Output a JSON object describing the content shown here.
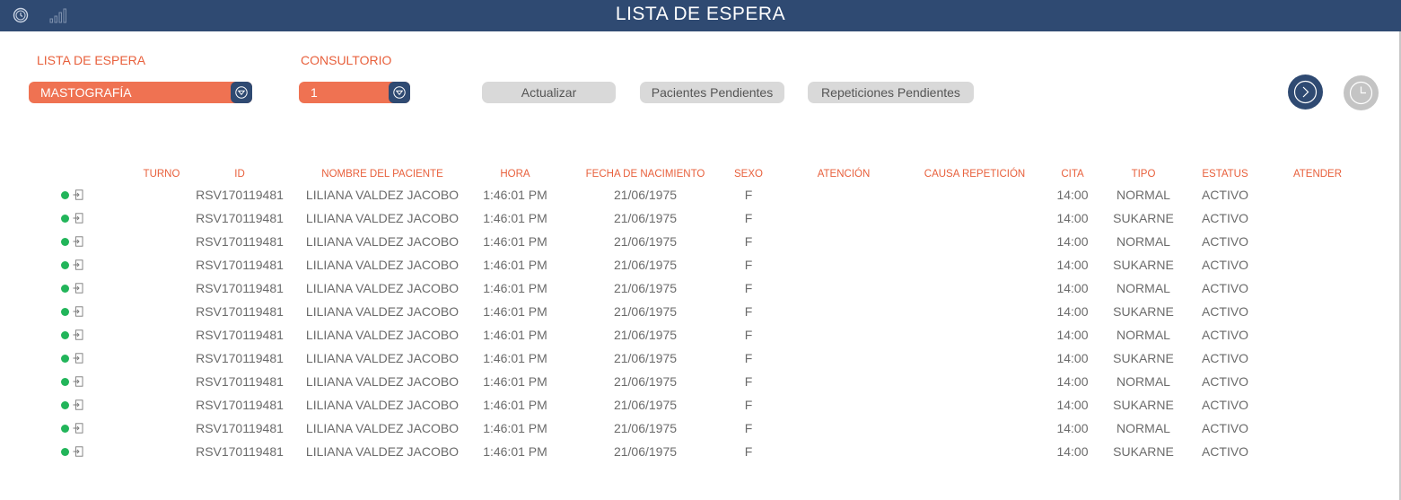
{
  "header": {
    "title": "LISTA DE ESPERA",
    "history_icon": "history-icon",
    "chart_icon": "signal-bars-icon"
  },
  "colors": {
    "header_bg": "#2f4a72",
    "accent": "#ef7252",
    "label": "#e8603c",
    "status_dot": "#22b55a",
    "button_bg": "#d9d9d9"
  },
  "filters": {
    "lista_label": "LISTA DE ESPERA",
    "lista_value": "MASTOGRAFÍA",
    "consultorio_label": "CONSULTORIO",
    "consultorio_value": "1"
  },
  "buttons": {
    "actualizar": "Actualizar",
    "pacientes_pendientes": "Pacientes Pendientes",
    "repeticiones_pendientes": "Repeticiones Pendientes"
  },
  "table": {
    "columns": [
      "TURNO",
      "ID",
      "NOMBRE DEL PACIENTE",
      "HORA",
      "FECHA DE NACIMIENTO",
      "SEXO",
      "ATENCIÓN",
      "CAUSA REPETICIÓN",
      "CITA",
      "TIPO",
      "ESTATUS",
      "ATENDER"
    ],
    "rows": [
      {
        "turno": "",
        "id": "RSV170119481",
        "nombre": "LILIANA VALDEZ JACOBO",
        "hora": "1:46:01 PM",
        "fecha": "21/06/1975",
        "sexo": "F",
        "atencion": "",
        "causa": "",
        "cita": "14:00",
        "tipo": "NORMAL",
        "estatus": "ACTIVO",
        "atender": ""
      },
      {
        "turno": "",
        "id": "RSV170119481",
        "nombre": "LILIANA VALDEZ JACOBO",
        "hora": "1:46:01 PM",
        "fecha": "21/06/1975",
        "sexo": "F",
        "atencion": "",
        "causa": "",
        "cita": "14:00",
        "tipo": "SUKARNE",
        "estatus": "ACTIVO",
        "atender": ""
      },
      {
        "turno": "",
        "id": "RSV170119481",
        "nombre": "LILIANA VALDEZ JACOBO",
        "hora": "1:46:01 PM",
        "fecha": "21/06/1975",
        "sexo": "F",
        "atencion": "",
        "causa": "",
        "cita": "14:00",
        "tipo": "NORMAL",
        "estatus": "ACTIVO",
        "atender": ""
      },
      {
        "turno": "",
        "id": "RSV170119481",
        "nombre": "LILIANA VALDEZ JACOBO",
        "hora": "1:46:01 PM",
        "fecha": "21/06/1975",
        "sexo": "F",
        "atencion": "",
        "causa": "",
        "cita": "14:00",
        "tipo": "SUKARNE",
        "estatus": "ACTIVO",
        "atender": ""
      },
      {
        "turno": "",
        "id": "RSV170119481",
        "nombre": "LILIANA VALDEZ JACOBO",
        "hora": "1:46:01 PM",
        "fecha": "21/06/1975",
        "sexo": "F",
        "atencion": "",
        "causa": "",
        "cita": "14:00",
        "tipo": "NORMAL",
        "estatus": "ACTIVO",
        "atender": ""
      },
      {
        "turno": "",
        "id": "RSV170119481",
        "nombre": "LILIANA VALDEZ JACOBO",
        "hora": "1:46:01 PM",
        "fecha": "21/06/1975",
        "sexo": "F",
        "atencion": "",
        "causa": "",
        "cita": "14:00",
        "tipo": "SUKARNE",
        "estatus": "ACTIVO",
        "atender": ""
      },
      {
        "turno": "",
        "id": "RSV170119481",
        "nombre": "LILIANA VALDEZ JACOBO",
        "hora": "1:46:01 PM",
        "fecha": "21/06/1975",
        "sexo": "F",
        "atencion": "",
        "causa": "",
        "cita": "14:00",
        "tipo": "NORMAL",
        "estatus": "ACTIVO",
        "atender": ""
      },
      {
        "turno": "",
        "id": "RSV170119481",
        "nombre": "LILIANA VALDEZ JACOBO",
        "hora": "1:46:01 PM",
        "fecha": "21/06/1975",
        "sexo": "F",
        "atencion": "",
        "causa": "",
        "cita": "14:00",
        "tipo": "SUKARNE",
        "estatus": "ACTIVO",
        "atender": ""
      },
      {
        "turno": "",
        "id": "RSV170119481",
        "nombre": "LILIANA VALDEZ JACOBO",
        "hora": "1:46:01 PM",
        "fecha": "21/06/1975",
        "sexo": "F",
        "atencion": "",
        "causa": "",
        "cita": "14:00",
        "tipo": "NORMAL",
        "estatus": "ACTIVO",
        "atender": ""
      },
      {
        "turno": "",
        "id": "RSV170119481",
        "nombre": "LILIANA VALDEZ JACOBO",
        "hora": "1:46:01 PM",
        "fecha": "21/06/1975",
        "sexo": "F",
        "atencion": "",
        "causa": "",
        "cita": "14:00",
        "tipo": "SUKARNE",
        "estatus": "ACTIVO",
        "atender": ""
      },
      {
        "turno": "",
        "id": "RSV170119481",
        "nombre": "LILIANA VALDEZ JACOBO",
        "hora": "1:46:01 PM",
        "fecha": "21/06/1975",
        "sexo": "F",
        "atencion": "",
        "causa": "",
        "cita": "14:00",
        "tipo": "NORMAL",
        "estatus": "ACTIVO",
        "atender": ""
      },
      {
        "turno": "",
        "id": "RSV170119481",
        "nombre": "LILIANA VALDEZ JACOBO",
        "hora": "1:46:01 PM",
        "fecha": "21/06/1975",
        "sexo": "F",
        "atencion": "",
        "causa": "",
        "cita": "14:00",
        "tipo": "SUKARNE",
        "estatus": "ACTIVO",
        "atender": ""
      }
    ]
  }
}
